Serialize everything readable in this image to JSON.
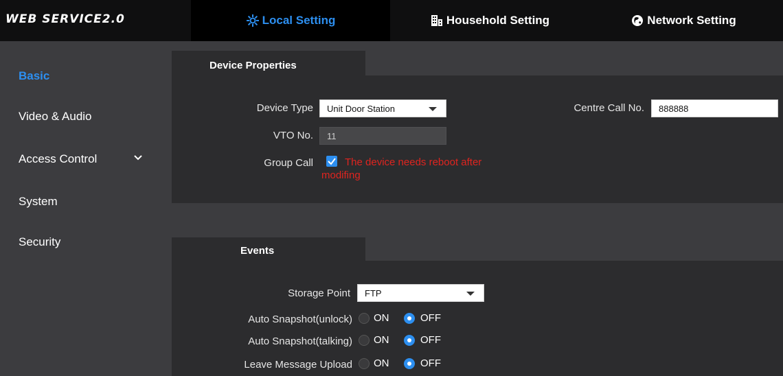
{
  "header": {
    "logo": "WEB SERVICE2.0",
    "tabs": [
      {
        "label": "Local Setting",
        "icon": "gear-icon",
        "active": true
      },
      {
        "label": "Household Setting",
        "icon": "building-icon",
        "active": false
      },
      {
        "label": "Network Setting",
        "icon": "globe-icon",
        "active": false
      }
    ]
  },
  "sidebar": {
    "items": [
      {
        "label": "Basic",
        "active": true
      },
      {
        "label": "Video & Audio"
      },
      {
        "label": "Access Control",
        "expandable": true
      },
      {
        "label": "System"
      },
      {
        "label": "Security"
      }
    ]
  },
  "device_properties": {
    "tab_label": "Device Properties",
    "device_type_label": "Device Type",
    "device_type_value": "Unit Door Station",
    "centre_call_label": "Centre Call No.",
    "centre_call_value": "888888",
    "vto_label": "VTO No.",
    "vto_value": "11",
    "group_call_label": "Group Call",
    "group_call_checked": true,
    "warning_line1": "The device needs reboot after",
    "warning_line2": "modifing"
  },
  "events": {
    "tab_label": "Events",
    "storage_point_label": "Storage Point",
    "storage_point_value": "FTP",
    "rows": [
      {
        "label": "Auto Snapshot(unlock)",
        "on_label": "ON",
        "off_label": "OFF",
        "selected": "OFF"
      },
      {
        "label": "Auto Snapshot(talking)",
        "on_label": "ON",
        "off_label": "OFF",
        "selected": "OFF"
      },
      {
        "label": "Leave Message Upload",
        "on_label": "ON",
        "off_label": "OFF",
        "selected": "OFF"
      }
    ]
  },
  "colors": {
    "accent": "#2d8ff0",
    "warning": "#e0241f",
    "topbar": "#0f0f10",
    "panel": "#2c2c2e",
    "background": "#3c3c3f"
  }
}
